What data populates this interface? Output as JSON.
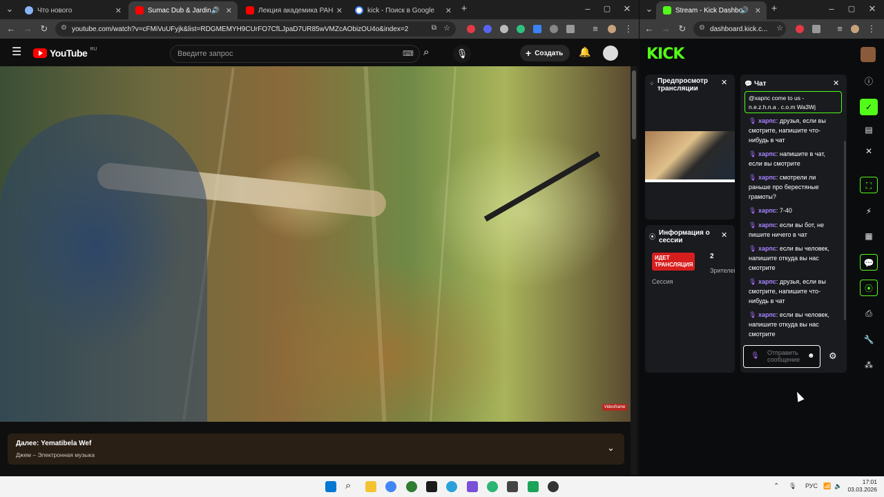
{
  "left_window": {
    "tabs": [
      {
        "title": "Что нового",
        "fav_color": "#8ab4f8"
      },
      {
        "title": "Sumac Dub & Jardin Secret",
        "fav_color": "#ff0000",
        "active": true
      },
      {
        "title": "Лекция академика РАН А. А. Зал",
        "fav_color": "#ff0000"
      },
      {
        "title": "kick - Поиск в Google",
        "fav_color": "#4285f4"
      }
    ],
    "new_tab": "+",
    "url": "youtube.com/watch?v=cFMiVuUFyjk&list=RDGMEMYH9CUrFO7CfLJpaD7UR85wVMZcAObizOU4o&index=2",
    "youtube": {
      "logo_text": "YouTube",
      "region": "RU",
      "search_placeholder": "Введите запрос",
      "create_label": "Создать",
      "watermark": "Videoframe"
    },
    "up_next": {
      "title": "Далее: Yematibela Wef",
      "subtitle": "Джем – Электронная музыка"
    }
  },
  "right_window": {
    "tab_title": "Stream - Kick Dashboard",
    "url": "dashboard.kick.c...",
    "logo": "KICK",
    "preview_panel": {
      "title_line1": "Предпросмотр",
      "title_line2": "трансляции"
    },
    "session_panel": {
      "title_line1": "Информация о",
      "title_line2": "сессии",
      "live_badge_line1": "ИДЕТ",
      "live_badge_line2": "ТРАНСЛЯЦИЯ",
      "session_label": "Сессия",
      "viewers_count": "2",
      "viewers_label": "Зрителей"
    },
    "chat_panel": {
      "title": "Чат",
      "highlighted": {
        "line1": "@харпс come to us -",
        "line2": "n.e.z.h.n.a . c.o.m Wa3Wj"
      },
      "messages": [
        {
          "user": "харпс",
          "l1": ": друзья, если вы",
          "l2": "смотрите, напишите что-",
          "l3": "нибудь в чат"
        },
        {
          "user": "харпс",
          "l1": ": напишите в чат,",
          "l2": "если вы смотрите",
          "l3": ""
        },
        {
          "user": "харпс",
          "l1": ": смотрели ли",
          "l2": "раньше про берестяные",
          "l3": "грамоты?"
        },
        {
          "user": "харпс",
          "l1": ": 7-40",
          "l2": "",
          "l3": ""
        },
        {
          "user": "харпс",
          "l1": ": если вы бот, не",
          "l2": "пишите ничего в чат",
          "l3": ""
        },
        {
          "user": "харпс",
          "l1": ": если вы человек,",
          "l2": "напишите откуда вы нас",
          "l3": "смотрите"
        },
        {
          "user": "харпс",
          "l1": ": друзья, если вы",
          "l2": "смотрите, напишите что-",
          "l3": "нибудь в чат"
        },
        {
          "user": "харпс",
          "l1": ": если вы человек,",
          "l2": "напишите откуда вы нас",
          "l3": "смотрите"
        }
      ],
      "input_placeholder_l1": "Отправить",
      "input_placeholder_l2": "сообщение"
    }
  },
  "taskbar": {
    "lang": "РУС",
    "time": "17:01",
    "date": "03.03.2026"
  },
  "colors": {
    "kick_green": "#53fc18",
    "live_red": "#d71e1e",
    "yt_red": "#ff0000"
  }
}
